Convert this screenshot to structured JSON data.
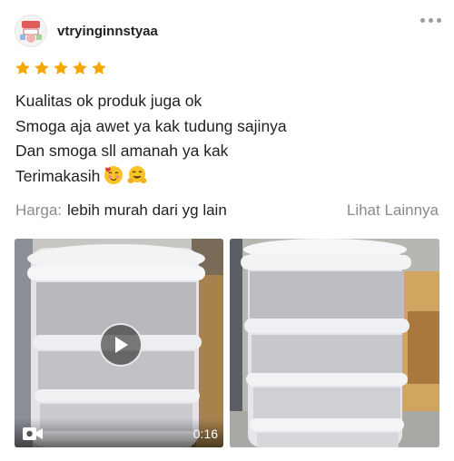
{
  "user": {
    "username": "vtryinginnstyaa"
  },
  "rating": {
    "stars": 5,
    "color": "#f6a700"
  },
  "review": {
    "lines": [
      "Kualitas ok produk juga ok",
      "Smoga aja awet ya kak tudung sajinya",
      "Dan smoga sll amanah ya kak",
      "Terimakasih"
    ],
    "emojis": [
      "🥰",
      "🤗"
    ]
  },
  "price": {
    "label": "Harga:",
    "value": "lebih murah dari yg lain"
  },
  "see_more": "Lihat Lainnya",
  "media": [
    {
      "type": "video",
      "duration": "0:16",
      "icons": [
        "play-icon",
        "video-camera-icon"
      ]
    },
    {
      "type": "image"
    }
  ],
  "icons": [
    "more-options-icon",
    "star-icon"
  ]
}
